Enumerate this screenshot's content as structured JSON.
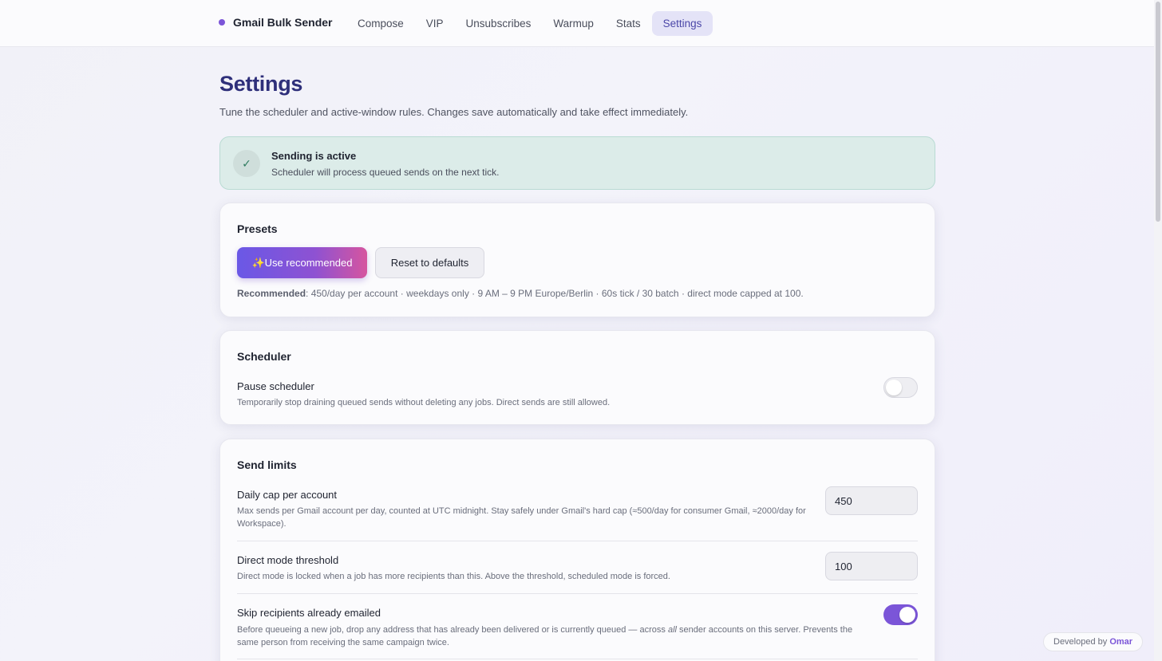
{
  "app": {
    "name": "Gmail Bulk Sender"
  },
  "nav": {
    "items": [
      {
        "label": "Compose",
        "active": false
      },
      {
        "label": "VIP",
        "active": false
      },
      {
        "label": "Unsubscribes",
        "active": false
      },
      {
        "label": "Warmup",
        "active": false
      },
      {
        "label": "Stats",
        "active": false
      },
      {
        "label": "Settings",
        "active": true
      }
    ]
  },
  "page": {
    "title": "Settings",
    "subtitle": "Tune the scheduler and active-window rules. Changes save automatically and take effect immediately."
  },
  "status": {
    "icon": "check-icon",
    "title": "Sending is active",
    "description": "Scheduler will process queued sends on the next tick."
  },
  "presets": {
    "title": "Presets",
    "recommended_button": "✨Use recommended",
    "reset_button": "Reset to defaults",
    "note_label": "Recommended",
    "note_text": ": 450/day per account · weekdays only · 9 AM – 9 PM Europe/Berlin · 60s tick / 30 batch · direct mode capped at 100."
  },
  "scheduler": {
    "title": "Scheduler",
    "pause_label": "Pause scheduler",
    "pause_description": "Temporarily stop draining queued sends without deleting any jobs. Direct sends are still allowed.",
    "paused": false
  },
  "send_limits": {
    "title": "Send limits",
    "daily_cap_label": "Daily cap per account",
    "daily_cap_description": "Max sends per Gmail account per day, counted at UTC midnight. Stay safely under Gmail's hard cap (≈500/day for consumer Gmail, ≈2000/day for Workspace).",
    "daily_cap_value": "450",
    "direct_threshold_label": "Direct mode threshold",
    "direct_threshold_description": "Direct mode is locked when a job has more recipients than this. Above the threshold, scheduled mode is forced.",
    "direct_threshold_value": "100",
    "skip_label": "Skip recipients already emailed",
    "skip_description_before": "Before queueing a new job, drop any address that has already been delivered or is currently queued — across ",
    "skip_description_emphasis": "all",
    "skip_description_after": " sender accounts on this server. Prevents the same person from receiving the same campaign twice.",
    "skip_enabled": true
  },
  "footer": {
    "developed_by": "Developed by",
    "author": "Omar"
  },
  "colors": {
    "accent": "#7b55d8",
    "title": "#2e2f7a",
    "success_bg": "#dcece9",
    "success_icon": "#2e7b5f"
  }
}
